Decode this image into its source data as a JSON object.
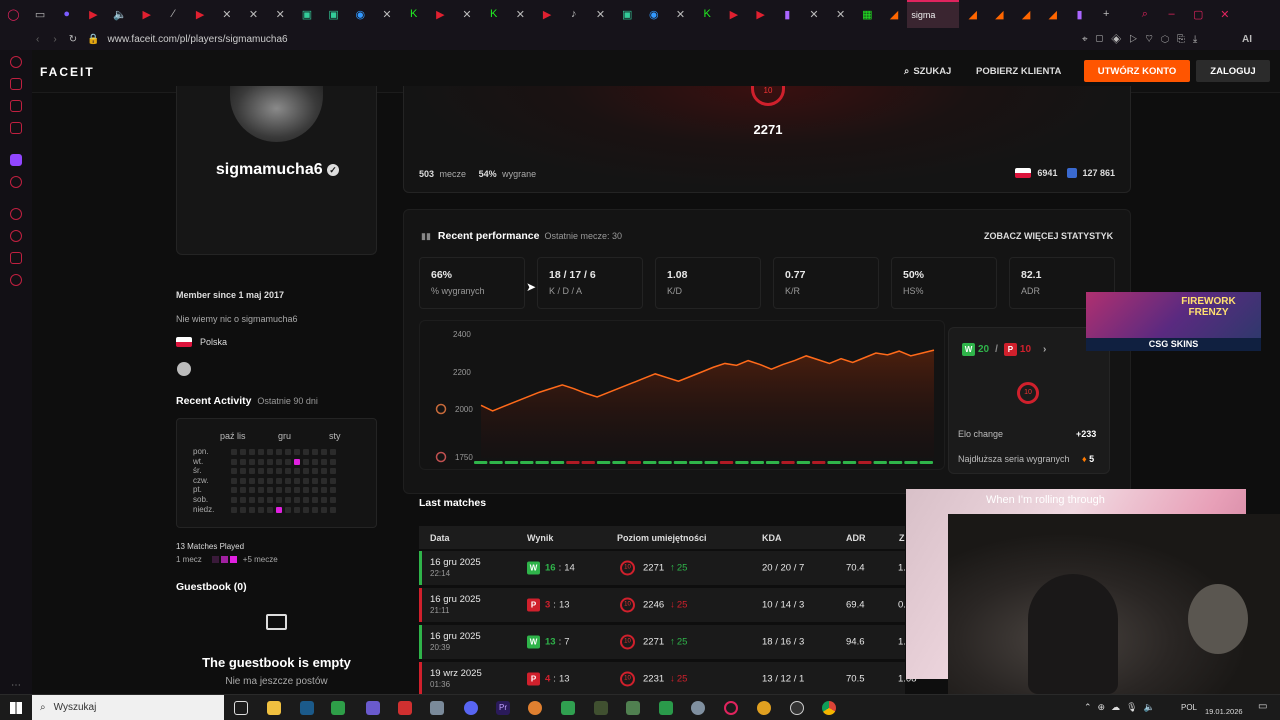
{
  "browser": {
    "active_tab_label": "sigma",
    "url": "www.faceit.com/pl/players/sigmamucha6",
    "ai_label": "AI"
  },
  "header": {
    "logo": "FACEIT",
    "search_label": "SZUKAJ",
    "download_label": "POBIERZ KLIENTA",
    "create_account_label": "UTWÓRZ KONTO",
    "login_label": "ZALOGUJ"
  },
  "profile": {
    "username": "sigmamucha6",
    "level": "10",
    "elo": "2271",
    "matches_count": "503",
    "matches_word": "mecze",
    "winrate": "54%",
    "winrate_word": "wygrane",
    "country_rank": "6941",
    "region_rank": "127 861",
    "member_since": "Member since 1 maj 2017",
    "about": "Nie wiemy nic o sigmamucha6",
    "country": "Polska"
  },
  "activity": {
    "title": "Recent Activity",
    "subtitle": "Ostatnie 90 dni",
    "months": [
      "paź lis",
      "gru",
      "sty"
    ],
    "days": [
      "pon.",
      "wt.",
      "śr.",
      "czw.",
      "pt.",
      "sob.",
      "niedz."
    ],
    "matches_played": "13 Matches Played",
    "legend_left": "1 mecz",
    "legend_right": "+5 mecze"
  },
  "guestbook": {
    "title": "Guestbook (0)",
    "empty_title": "The guestbook is empty",
    "empty_subtitle": "Nie ma jeszcze postów"
  },
  "performance": {
    "title": "Recent performance",
    "subtitle": "Ostatnie mecze: 30",
    "more_link": "ZOBACZ WIĘCEJ STATYSTYK",
    "stats": [
      {
        "value": "66%",
        "label": "% wygranych"
      },
      {
        "value": "18 / 17 / 6",
        "label": "K / D / A"
      },
      {
        "value": "1.08",
        "label": "K/D"
      },
      {
        "value": "0.77",
        "label": "K/R"
      },
      {
        "value": "50%",
        "label": "HS%"
      },
      {
        "value": "82.1",
        "label": "ADR"
      }
    ],
    "wins": "20",
    "losses": "10",
    "elo_change_label": "Elo change",
    "elo_change_value": "+233",
    "streak_label": "Najdłuższa seria wygranych",
    "streak_value": "5"
  },
  "chart_data": {
    "type": "line",
    "yticks": [
      "2400",
      "2200",
      "2000",
      "1750"
    ],
    "ylim": [
      1750,
      2400
    ],
    "values": [
      2020,
      1990,
      2015,
      2040,
      2065,
      2090,
      2110,
      2130,
      2110,
      2085,
      2065,
      2090,
      2115,
      2140,
      2165,
      2190,
      2170,
      2150,
      2175,
      2200,
      2225,
      2245,
      2235,
      2260,
      2240,
      2215,
      2240,
      2260,
      2285,
      2265,
      2245,
      2270,
      2250,
      2275,
      2300,
      2290,
      2310,
      2285,
      2300,
      2315
    ],
    "results": [
      "W",
      "W",
      "W",
      "W",
      "W",
      "W",
      "L",
      "L",
      "W",
      "W",
      "L",
      "W",
      "W",
      "W",
      "W",
      "W",
      "L",
      "W",
      "W",
      "W",
      "L",
      "W",
      "L",
      "W",
      "W",
      "L",
      "W",
      "W",
      "W",
      "W"
    ]
  },
  "last_matches": {
    "title": "Last matches",
    "columns": [
      "Data",
      "Wynik",
      "Poziom umiejętności",
      "KDA",
      "ADR",
      "Z"
    ],
    "rows": [
      {
        "date": "16 gru 2025",
        "time": "22:14",
        "result": "W",
        "score_a": "16",
        "score_b": "14",
        "elo": "2271",
        "delta": "25",
        "dir": "up",
        "kda": "20 / 20 / 7",
        "adr": "70.4",
        "kd": "1."
      },
      {
        "date": "16 gru 2025",
        "time": "21:11",
        "result": "L",
        "score_a": "3",
        "score_b": "13",
        "elo": "2246",
        "delta": "25",
        "dir": "down",
        "kda": "10 / 14 / 3",
        "adr": "69.4",
        "kd": "0."
      },
      {
        "date": "16 gru 2025",
        "time": "20:39",
        "result": "W",
        "score_a": "13",
        "score_b": "7",
        "elo": "2271",
        "delta": "25",
        "dir": "up",
        "kda": "18 / 16 / 3",
        "adr": "94.6",
        "kd": "1."
      },
      {
        "date": "19 wrz 2025",
        "time": "01:36",
        "result": "L",
        "score_a": "4",
        "score_b": "13",
        "elo": "2231",
        "delta": "25",
        "dir": "down",
        "kda": "13 / 12 / 1",
        "adr": "70.5",
        "kd": "1.08"
      }
    ]
  },
  "ad": {
    "title": "FIREWORK FRENZY",
    "brand": "CSG SKINS"
  },
  "webcam": {
    "caption": "When I'm rolling through"
  },
  "taskbar": {
    "search_placeholder": "Wyszukaj",
    "lang": "POL",
    "date": "19.01.2026"
  },
  "colors": {
    "accent": "#ff5500",
    "win": "#2fb44a",
    "loss": "#d0202c"
  }
}
